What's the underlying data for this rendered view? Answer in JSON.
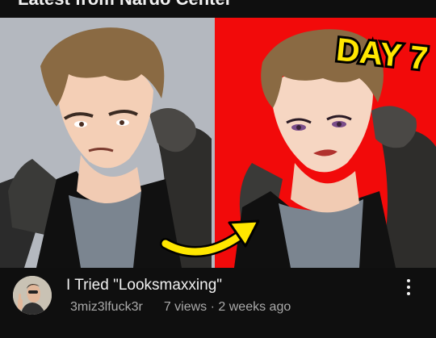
{
  "section": {
    "title": "Latest from Nardo Center"
  },
  "video": {
    "thumbnail_text": "DAY 7",
    "title": "I Tried \"Looksmaxxing\"",
    "channel": "3miz3lfuck3r",
    "views": "7 views",
    "separator": "·",
    "age": "2 weeks ago"
  },
  "colors": {
    "background": "#0f0f0f",
    "thumb_left_bg": "#b4b8bf",
    "thumb_right_bg": "#f20a0a",
    "accent_yellow": "#ffe600"
  },
  "icons": {
    "menu": "more-vert-icon",
    "arrow": "curved-arrow-icon"
  }
}
